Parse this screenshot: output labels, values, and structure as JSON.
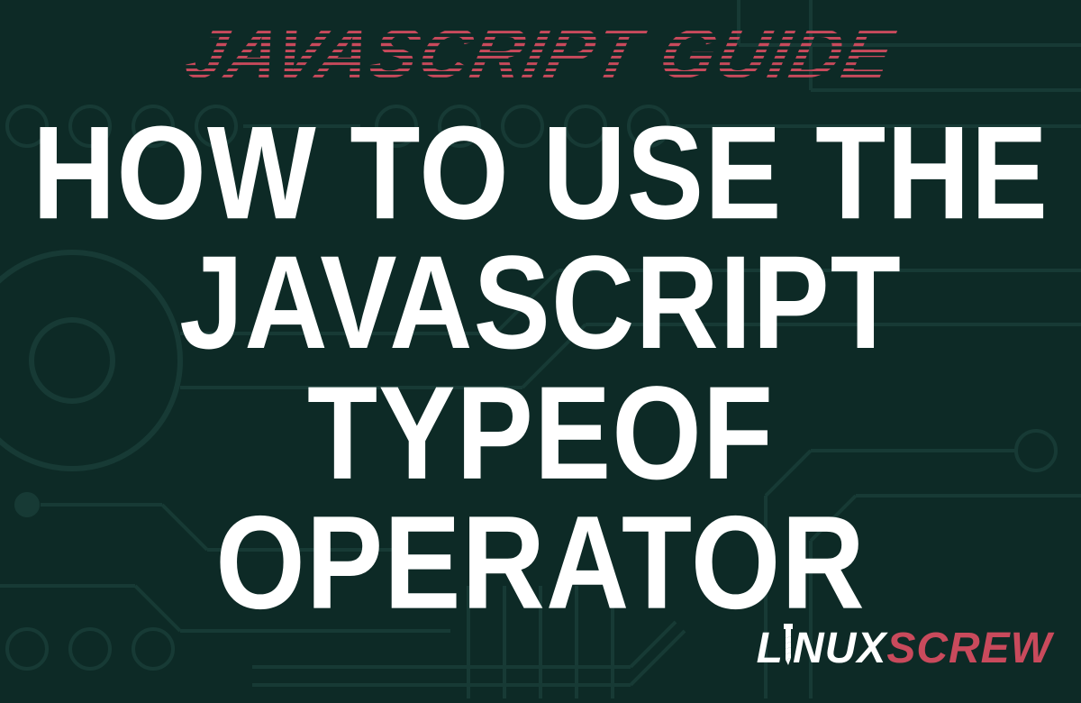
{
  "subtitle": "JAVASCRIPT GUIDE",
  "title": {
    "line1": "HOW TO USE THE",
    "line2": "JAVASCRIPT TYPEOF",
    "line3": "OPERATOR"
  },
  "brand": {
    "part1": "L",
    "part2": "NUX",
    "part3": "SCREW"
  },
  "colors": {
    "background": "#0d2a26",
    "accent": "#c94a5c",
    "text": "#ffffff",
    "circuit": "#1a4a42"
  }
}
